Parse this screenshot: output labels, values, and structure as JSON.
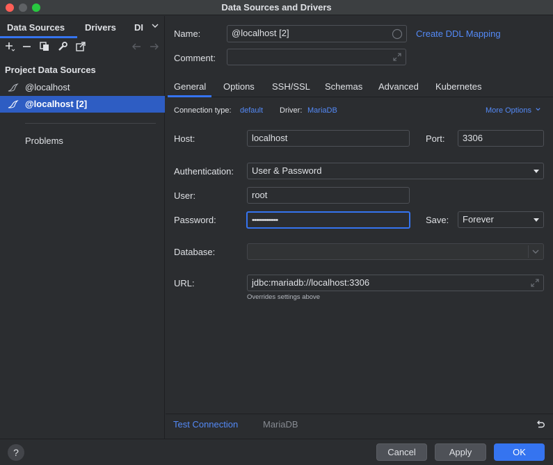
{
  "window": {
    "title": "Data Sources and Drivers"
  },
  "left": {
    "tabs": [
      "Data Sources",
      "Drivers",
      "DI"
    ],
    "section_title": "Project Data Sources",
    "items": [
      {
        "label": "@localhost",
        "selected": false
      },
      {
        "label": "@localhost [2]",
        "selected": true
      }
    ],
    "problems": "Problems"
  },
  "form": {
    "name_label": "Name:",
    "name_value": "@localhost [2]",
    "ddl_link": "Create DDL Mapping",
    "comment_label": "Comment:",
    "comment_value": "",
    "tabs": [
      "General",
      "Options",
      "SSH/SSL",
      "Schemas",
      "Advanced",
      "Kubernetes"
    ],
    "active_tab": "General",
    "conn_type_label": "Connection type:",
    "conn_type_value": "default",
    "driver_label": "Driver:",
    "driver_value": "MariaDB",
    "more_options": "More Options",
    "host_label": "Host:",
    "host_value": "localhost",
    "port_label": "Port:",
    "port_value": "3306",
    "auth_label": "Authentication:",
    "auth_value": "User & Password",
    "user_label": "User:",
    "user_value": "root",
    "password_label": "Password:",
    "password_value": "•••••••••••••",
    "save_label": "Save:",
    "save_value": "Forever",
    "database_label": "Database:",
    "database_value": "",
    "url_label": "URL:",
    "url_value": "jdbc:mariadb://localhost:3306",
    "url_hint": "Overrides settings above",
    "test_connection": "Test Connection",
    "driver_footer": "MariaDB"
  },
  "footer": {
    "help": "?",
    "cancel": "Cancel",
    "apply": "Apply",
    "ok": "OK"
  },
  "colors": {
    "accent": "#3574f0",
    "link": "#548af7",
    "selection": "#2e5dc3",
    "background": "#2b2d30"
  }
}
